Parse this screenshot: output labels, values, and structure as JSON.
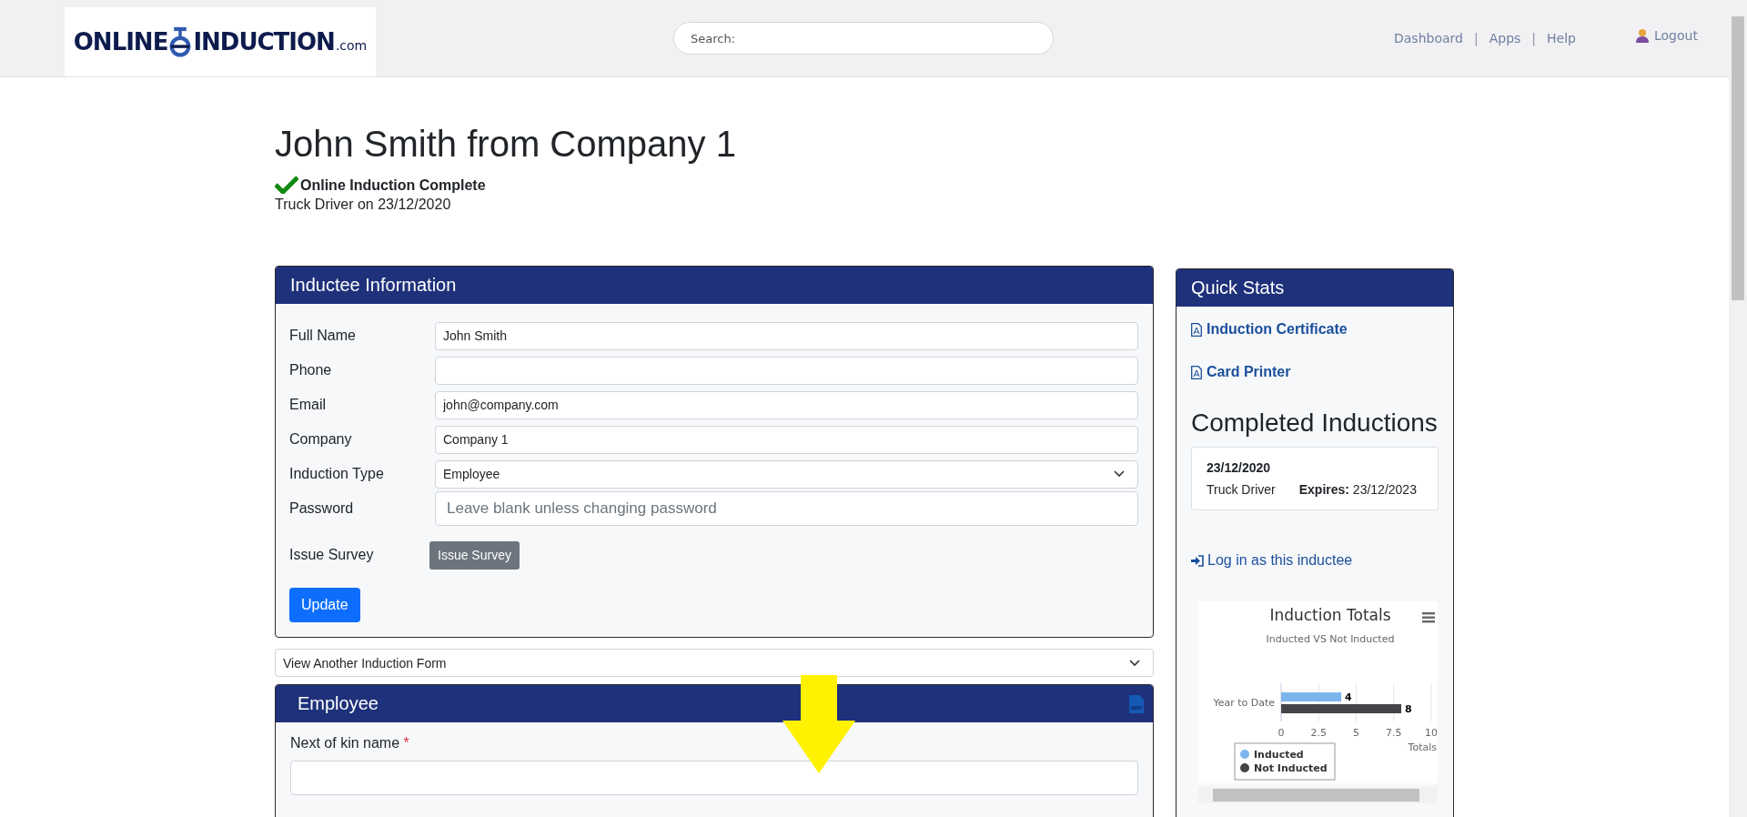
{
  "header": {
    "logo": {
      "left": "ONLINE",
      "right": "INDUCTION",
      "suffix": ".com"
    },
    "search": {
      "placeholder": "Search:"
    },
    "nav": [
      "Dashboard",
      "Apps",
      "Help"
    ],
    "nav_separator": "|",
    "logout": "Logout"
  },
  "page": {
    "title": "John Smith from Company 1",
    "status": "Online Induction Complete",
    "subtitle": "Truck Driver on 23/12/2020"
  },
  "inductee_panel": {
    "title": "Inductee Information",
    "fields": [
      {
        "label": "Full Name",
        "kind": "text",
        "value": "John Smith"
      },
      {
        "label": "Phone",
        "kind": "text"
      },
      {
        "label": "Email",
        "kind": "text",
        "value": "john@company.com"
      },
      {
        "label": "Company",
        "kind": "text",
        "value": "Company 1"
      },
      {
        "label": "Induction Type",
        "kind": "select",
        "value": "Employee"
      },
      {
        "label": "Password",
        "kind": "password",
        "placeholder": "Leave blank unless changing password"
      },
      {
        "label": "Issue Survey",
        "kind": "button",
        "value": "Issue Survey"
      }
    ],
    "submit": "Update"
  },
  "form_select": {
    "value": "View Another Induction Form"
  },
  "form_panel": {
    "title": "Employee",
    "fields": [
      {
        "label": "Next of kin name",
        "required_mark": "*"
      }
    ]
  },
  "quick_stats": {
    "title": "Quick Stats",
    "links": [
      "Induction Certificate",
      "Card Printer"
    ],
    "completed_title": "Completed Inductions",
    "completed": [
      {
        "date": "23/12/2020",
        "role": "Truck Driver",
        "expires_label": "Expires:",
        "expires": "23/12/2023"
      }
    ],
    "login_link": "Log in as this inductee",
    "chart": {
      "subtitle": "Inducted VS Not Inducted",
      "chart_data": {
        "type": "bar",
        "orientation": "horizontal",
        "title": "Induction Totals",
        "xlabel": "Totals",
        "categories": [
          "Year to Date"
        ],
        "series": [
          {
            "name": "Inducted",
            "color": "#7cb5ec",
            "values": [
              4
            ]
          },
          {
            "name": "Not Inducted",
            "color": "#434348",
            "values": [
              8
            ]
          }
        ],
        "xlim": [
          0,
          10
        ],
        "xticks": [
          0,
          2.5,
          5,
          7.5,
          10
        ],
        "data_labels": true,
        "grid": true,
        "legend": true
      }
    }
  }
}
